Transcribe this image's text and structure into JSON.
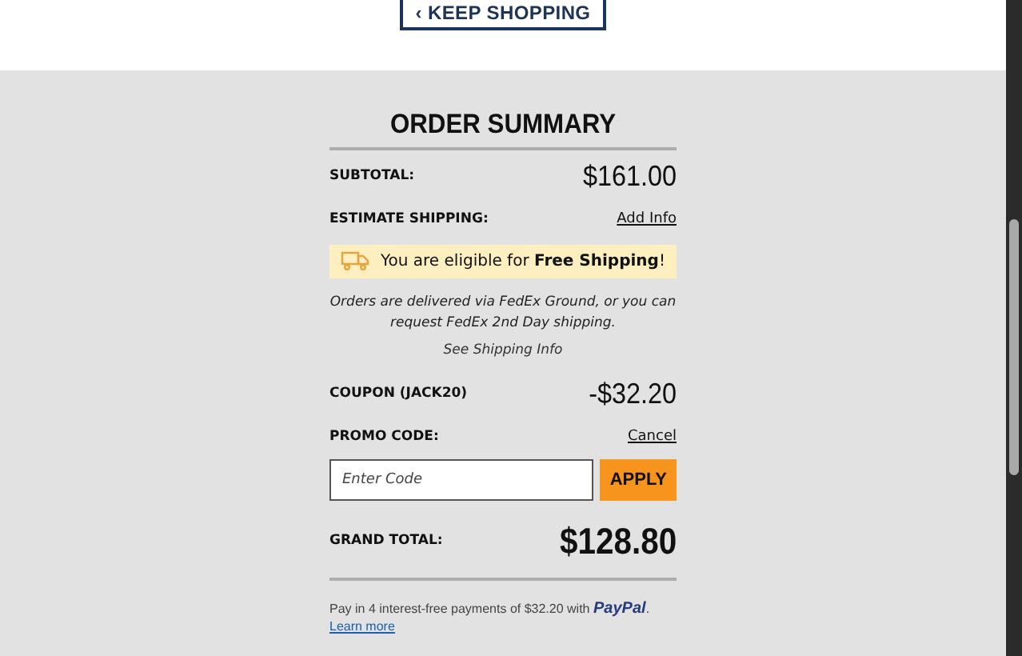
{
  "keep_shopping": {
    "icon": "‹",
    "label": "KEEP SHOPPING"
  },
  "order_summary": {
    "title": "ORDER SUMMARY",
    "subtotal": {
      "label": "SUBTOTAL:",
      "value": "$161.00"
    },
    "estimate_shipping": {
      "label": "ESTIMATE SHIPPING:",
      "link": "Add Info"
    },
    "free_shipping_banner": "You are eligible for **Free Shipping**!",
    "delivery_note": "Orders are delivered via FedEx Ground, or you can request FedEx 2nd Day shipping.",
    "shipping_info_link": "See Shipping Info",
    "coupon": {
      "label": "COUPON (JACK20)",
      "value": "-$32.20"
    },
    "promo_code": {
      "label": "PROMO CODE:",
      "link": "Cancel",
      "placeholder": "Enter Code",
      "button": "APPLY"
    },
    "grand_total": {
      "label": "GRAND TOTAL:",
      "value": "$128.80"
    },
    "paypal": {
      "text": "Pay in 4 interest-free payments of $32.20 with",
      "logo": "PayPal",
      "suffix": ".",
      "link": "Learn more"
    }
  }
}
